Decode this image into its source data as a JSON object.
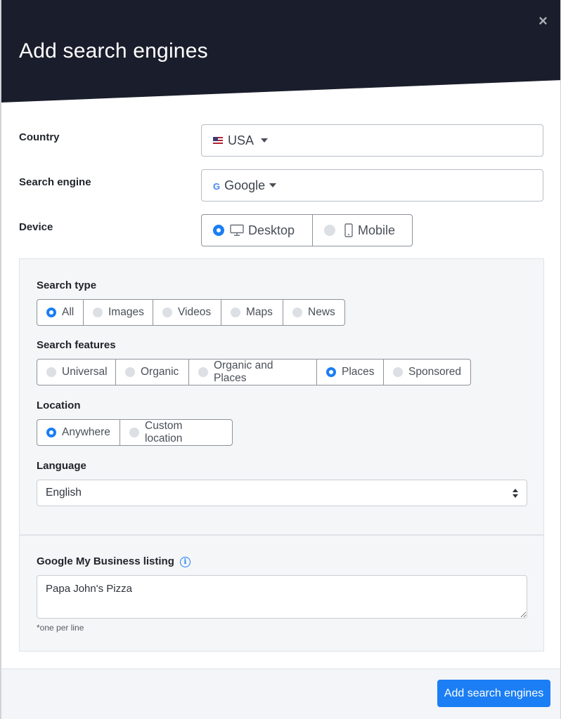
{
  "dialog": {
    "title": "Add search engines",
    "close_label": "×"
  },
  "country": {
    "label": "Country",
    "value": "USA",
    "flag_icon": "us-flag-icon"
  },
  "search_engine": {
    "label": "Search engine",
    "icon_text": "G",
    "value": "Google"
  },
  "device": {
    "label": "Device",
    "options": [
      {
        "label": "Desktop",
        "selected": true,
        "icon": "desktop-icon"
      },
      {
        "label": "Mobile",
        "selected": false,
        "icon": "mobile-icon"
      }
    ]
  },
  "search_type": {
    "label": "Search type",
    "options": [
      {
        "label": "All",
        "selected": true
      },
      {
        "label": "Images",
        "selected": false
      },
      {
        "label": "Videos",
        "selected": false
      },
      {
        "label": "Maps",
        "selected": false
      },
      {
        "label": "News",
        "selected": false
      }
    ]
  },
  "search_features": {
    "label": "Search features",
    "options": [
      {
        "label": "Universal",
        "selected": false
      },
      {
        "label": "Organic",
        "selected": false
      },
      {
        "label": "Organic and Places",
        "selected": false
      },
      {
        "label": "Places",
        "selected": true
      },
      {
        "label": "Sponsored",
        "selected": false
      }
    ]
  },
  "location": {
    "label": "Location",
    "options": [
      {
        "label": "Anywhere",
        "selected": true
      },
      {
        "label": "Custom location",
        "selected": false
      }
    ]
  },
  "language": {
    "label": "Language",
    "value": "English"
  },
  "gmb": {
    "label": "Google My Business listing",
    "info_icon": "i",
    "value": "Papa John's Pizza",
    "hint": "*one per line"
  },
  "footer": {
    "submit_label": "Add search engines"
  },
  "colors": {
    "header_bg": "#1a1d2b",
    "accent": "#1b7ef4"
  }
}
